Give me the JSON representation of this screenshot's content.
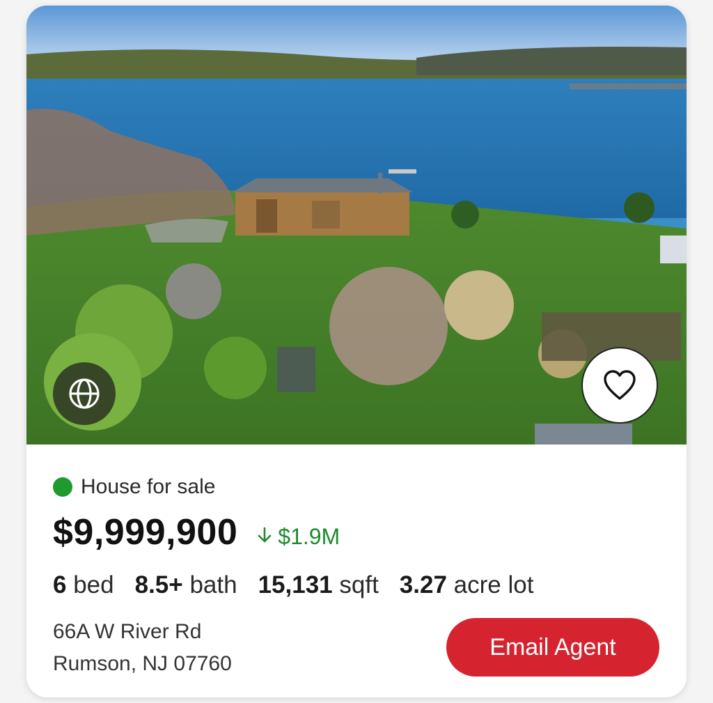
{
  "listing": {
    "status_text": "House for sale",
    "price": "$9,999,900",
    "price_change": "$1.9M",
    "specs": [
      {
        "value": "6",
        "unit": "bed"
      },
      {
        "value": "8.5+",
        "unit": "bath"
      },
      {
        "value": "15,131",
        "unit": "sqft"
      },
      {
        "value": "3.27",
        "unit": "acre lot"
      }
    ],
    "address_line1": "66A W River Rd",
    "address_line2": "Rumson, NJ 07760",
    "email_button_label": "Email Agent"
  },
  "icons": {
    "tour": "globe-icon",
    "favorite": "heart-icon",
    "price_change": "arrow-down-icon"
  },
  "colors": {
    "status_dot": "#1e9a2e",
    "price_drop": "#1e8a2e",
    "email_button": "#d5232f"
  }
}
